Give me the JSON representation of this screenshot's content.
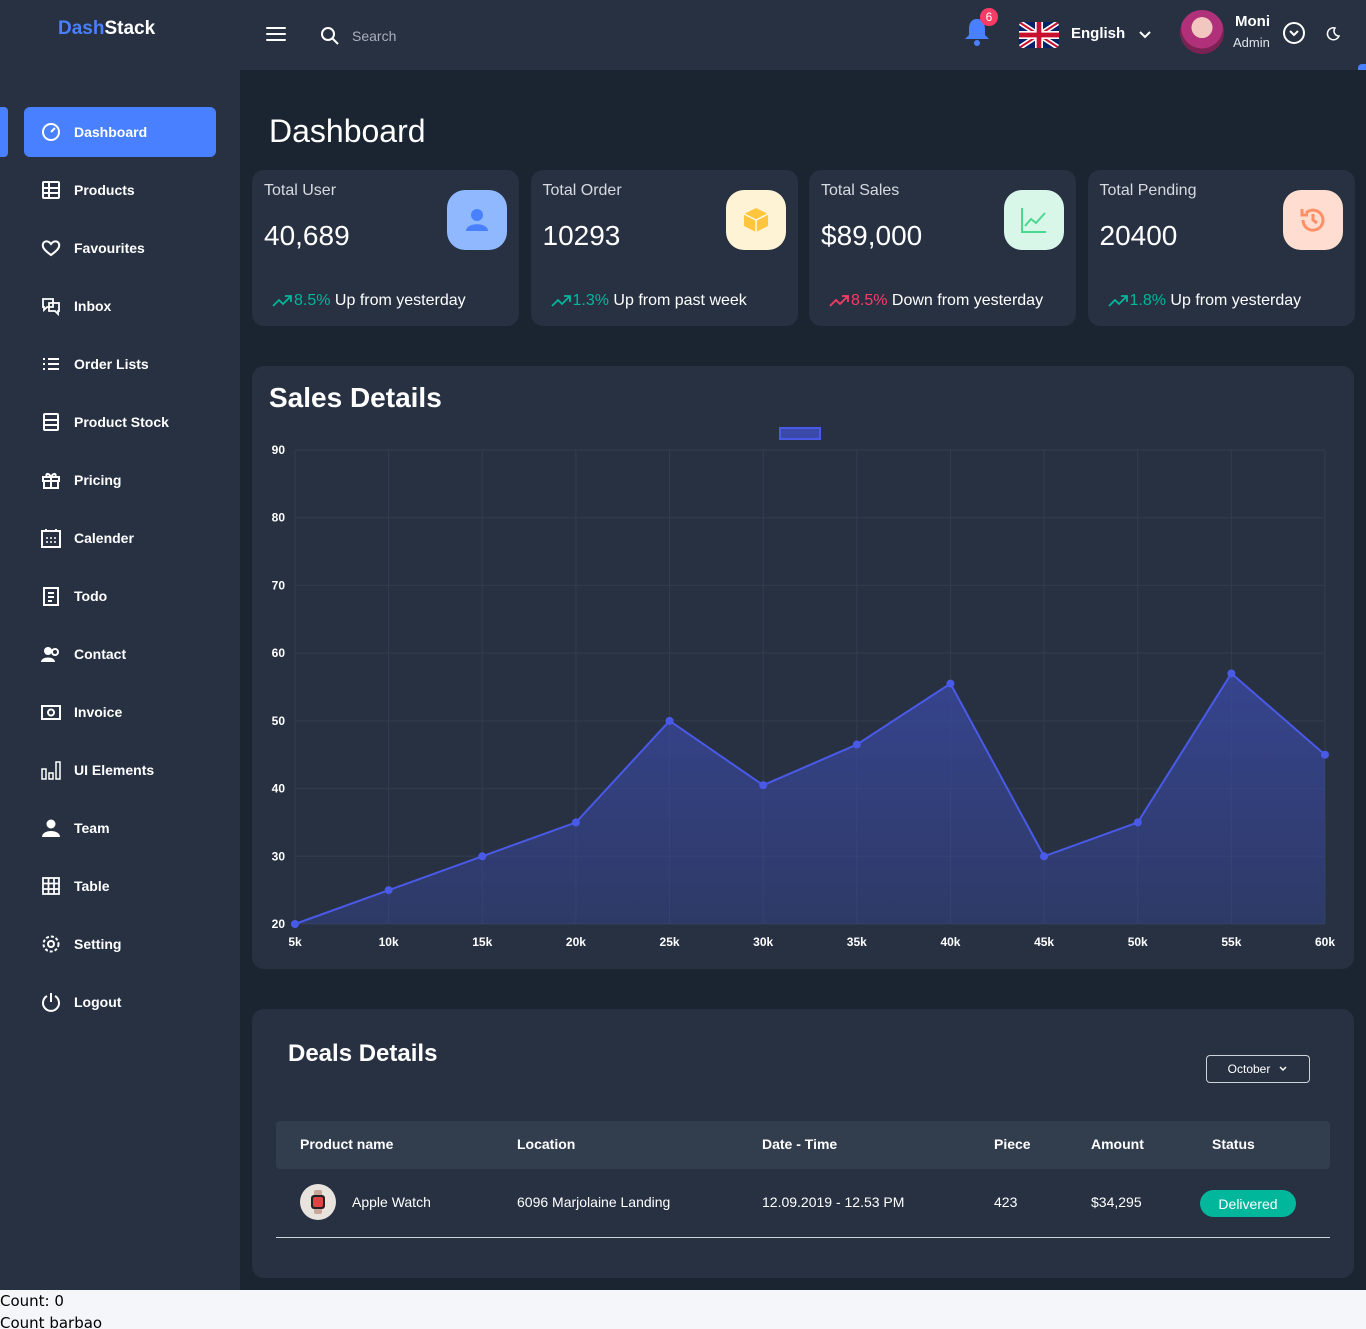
{
  "app": {
    "logo_a": "Dash",
    "logo_b": "Stack"
  },
  "header": {
    "search_placeholder": "Search",
    "notification_count": "6",
    "language": "English",
    "user_name": "Moni",
    "user_role": "Admin"
  },
  "sidebar": {
    "items": [
      {
        "label": "Dashboard",
        "icon": "dashboard-icon"
      },
      {
        "label": "Products",
        "icon": "grid-icon"
      },
      {
        "label": "Favourites",
        "icon": "heart-icon"
      },
      {
        "label": "Inbox",
        "icon": "inbox-icon"
      },
      {
        "label": "Order Lists",
        "icon": "list-icon"
      },
      {
        "label": "Product Stock",
        "icon": "stock-icon"
      },
      {
        "label": "Pricing",
        "icon": "gift-icon"
      },
      {
        "label": "Calender",
        "icon": "calendar-icon"
      },
      {
        "label": "Todo",
        "icon": "todo-icon"
      },
      {
        "label": "Contact",
        "icon": "contact-icon"
      },
      {
        "label": "Invoice",
        "icon": "invoice-icon"
      },
      {
        "label": "UI Elements",
        "icon": "ui-elements-icon"
      },
      {
        "label": "Team",
        "icon": "team-icon"
      },
      {
        "label": "Table",
        "icon": "table-icon"
      },
      {
        "label": "Setting",
        "icon": "gear-icon"
      },
      {
        "label": "Logout",
        "icon": "power-icon"
      }
    ]
  },
  "page": {
    "title": "Dashboard"
  },
  "cards": [
    {
      "title": "Total User",
      "value": "40,689",
      "pct": "8.5%",
      "trend_text": " Up from yesterday",
      "direction": "up",
      "icon": "user-icon",
      "icon_bg": "#8fb8ff"
    },
    {
      "title": "Total Order",
      "value": "10293",
      "pct": "1.3%",
      "trend_text": " Up from past week",
      "direction": "up",
      "icon": "box-icon",
      "icon_bg": "#fff3d6"
    },
    {
      "title": "Total Sales",
      "value": "$89,000",
      "pct": "8.5%",
      "trend_text": " Down from yesterday",
      "direction": "down",
      "icon": "line-chart-icon",
      "icon_bg": "#d9f7e8"
    },
    {
      "title": "Total Pending",
      "value": "20400",
      "pct": "1.8%",
      "trend_text": " Up from yesterday",
      "direction": "up",
      "icon": "history-icon",
      "icon_bg": "#ffded1"
    }
  ],
  "sales": {
    "title": "Sales Details"
  },
  "chart_data": {
    "type": "area",
    "title": "Sales Details",
    "x": [
      "5k",
      "10k",
      "15k",
      "20k",
      "25k",
      "30k",
      "35k",
      "40k",
      "45k",
      "50k",
      "55k",
      "60k"
    ],
    "series": [
      {
        "values": [
          20,
          25,
          30,
          35,
          50,
          40.5,
          46.5,
          55.5,
          30,
          35,
          57,
          45
        ]
      }
    ],
    "yticks": [
      20,
      30,
      40,
      50,
      60,
      70,
      80,
      90
    ],
    "ylim": [
      20,
      90
    ],
    "grid": true,
    "legend": "top-center",
    "colors": {
      "line": "#4a5ae8",
      "fill": "#3b4aa8"
    }
  },
  "deals": {
    "title": "Deals Details",
    "month": "October",
    "headers": [
      "Product name",
      "Location",
      "Date - Time",
      "Piece",
      "Amount",
      "Status"
    ],
    "rows": [
      {
        "product": "Apple Watch",
        "location": "6096 Marjolaine Landing",
        "datetime": "12.09.2019 - 12.53 PM",
        "piece": "423",
        "amount": "$34,295",
        "status": "Delivered"
      }
    ]
  },
  "footer": {
    "line1": "Count: 0",
    "line2": "Count barbao"
  }
}
